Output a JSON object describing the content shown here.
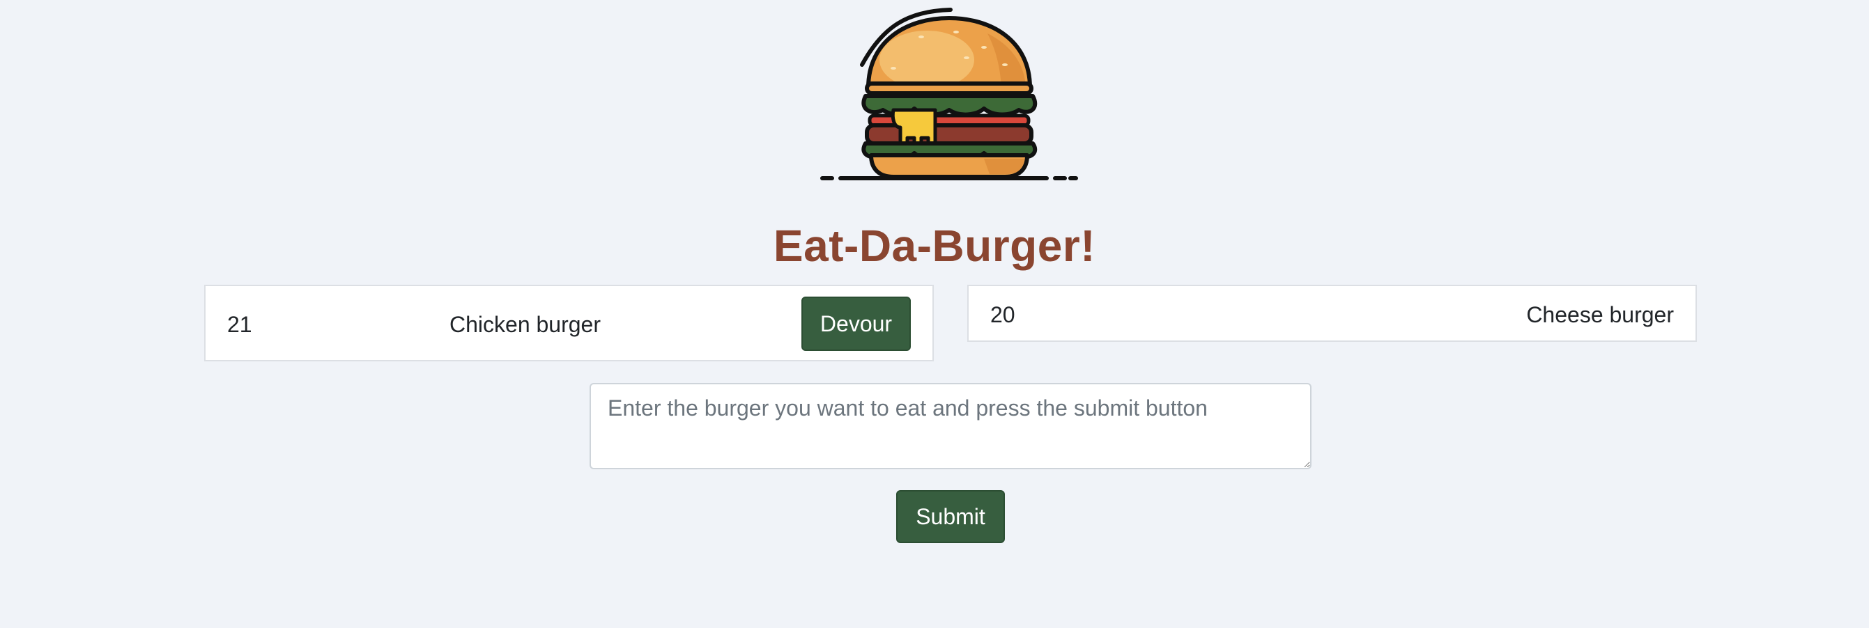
{
  "header": {
    "logo_icon": "burger-icon",
    "title": "Eat-Da-Burger!"
  },
  "burgers": {
    "to_eat": [
      {
        "id": "21",
        "name": "Chicken burger",
        "action_label": "Devour"
      }
    ],
    "devoured": [
      {
        "id": "20",
        "name": "Cheese burger"
      }
    ]
  },
  "form": {
    "input_value": "",
    "placeholder": "Enter the burger you want to eat and press the submit button",
    "submit_label": "Submit"
  },
  "colors": {
    "background": "#f0f3f8",
    "title": "#8a4530",
    "button": "#375e3f"
  }
}
